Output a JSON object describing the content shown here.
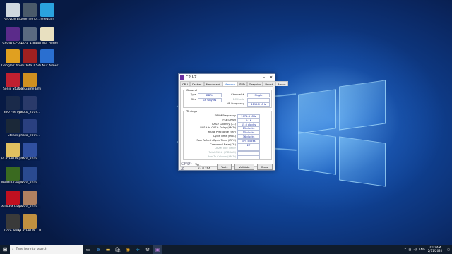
{
  "desktop_icons": [
    {
      "label": "Recycle Bin",
      "icon": "recycle-bin-icon",
      "color": "#cfd8e0"
    },
    {
      "label": "Core Temp...",
      "icon": "core-temp-shortcut-icon",
      "color": "#4a5a6a"
    },
    {
      "label": "Telegram",
      "icon": "telegram-icon",
      "color": "#2aa3de"
    },
    {
      "label": "CPUID CPU-Z",
      "icon": "cpu-z-icon",
      "color": "#5b2b8a"
    },
    {
      "label": "cpu-z_1.83...",
      "icon": "installer-icon",
      "color": "#5a6a80"
    },
    {
      "label": "Siti Nur Aimer Purwarni...",
      "icon": "document-icon",
      "color": "#e8e0c0"
    },
    {
      "label": "Google Chrome",
      "icon": "chrome-icon",
      "color": "#e0a020"
    },
    {
      "label": "Dota 2",
      "icon": "dota2-icon",
      "color": "#a02020"
    },
    {
      "label": "Siti Nur Aimer Purwarni...",
      "icon": "edge-document-icon",
      "color": "#2a6fd0"
    },
    {
      "label": "Sonic Studio",
      "icon": "sonic-studio-icon",
      "color": "#c02030"
    },
    {
      "label": "GeeGame Empire",
      "icon": "game-empire-icon",
      "color": "#d09020"
    },
    {
      "label": "SIIO File Pro",
      "icon": "file-pro-icon",
      "color": "#1a2a4a"
    },
    {
      "label": "photo_2019...",
      "icon": "photo-icon",
      "color": "#2a3a6a"
    },
    {
      "label": "Steam",
      "icon": "steam-icon",
      "color": "#1b2838"
    },
    {
      "label": "photo_2019...",
      "icon": "photo-icon",
      "color": "#2a4080"
    },
    {
      "label": "PLAYERUN... BATTLEGR...",
      "icon": "folder-icon",
      "color": "#e0c060"
    },
    {
      "label": "photo_2019...",
      "icon": "photo-icon",
      "color": "#3050a0"
    },
    {
      "label": "NVIDIA GeForce...",
      "icon": "nvidia-icon",
      "color": "#3a6a20"
    },
    {
      "label": "photo_2019...",
      "icon": "photo-icon",
      "color": "#2a4a90"
    },
    {
      "label": "AIDA64 Extreme",
      "icon": "aida64-icon",
      "color": "#c01020"
    },
    {
      "label": "photo_2019...",
      "icon": "photo-icon",
      "color": "#b08060"
    },
    {
      "label": "Core Temp",
      "icon": "core-temp-icon",
      "color": "#3a3a3a"
    },
    {
      "label": "PLAYERUN... BATTLEGR...",
      "icon": "pubg-icon",
      "color": "#c09040"
    }
  ],
  "cpuz": {
    "title": "CPU-Z",
    "tabs": [
      "CPU",
      "Caches",
      "Mainboard",
      "Memory",
      "SPD",
      "Graphics",
      "Bench",
      "About"
    ],
    "active_tab": "Memory",
    "general": {
      "title": "General",
      "type_label": "Type",
      "type_value": "DDR4",
      "size_label": "Size",
      "size_value": "16 GBytes",
      "channel_label": "Channel #",
      "channel_value": "Single",
      "dc_mode_label": "DC Mode",
      "nb_freq_label": "NB Frequency",
      "nb_freq_value": "4115.0 MHz"
    },
    "timings": {
      "title": "Timings",
      "rows": [
        {
          "label": "DRAM Frequency",
          "value": "1071.4 MHz",
          "dim": false
        },
        {
          "label": "FSB:DRAM",
          "value": "1:16",
          "dim": false
        },
        {
          "label": "CAS# Latency (CL)",
          "value": "15.0 clocks",
          "dim": false
        },
        {
          "label": "RAS# to CAS# Delay (tRCD)",
          "value": "15 clocks",
          "dim": false
        },
        {
          "label": "RAS# Precharge (tRP)",
          "value": "15 clocks",
          "dim": false
        },
        {
          "label": "Cycle Time (tRAS)",
          "value": "36 clocks",
          "dim": false
        },
        {
          "label": "Row Refresh Cycle Time (tRFC)",
          "value": "374 clocks",
          "dim": false
        },
        {
          "label": "Command Rate (CR)",
          "value": "2T",
          "dim": false
        },
        {
          "label": "DRAM Idle Timer",
          "value": "",
          "dim": true
        },
        {
          "label": "Total CAS# (tRDRAM)",
          "value": "",
          "dim": true
        },
        {
          "label": "Row To Column (tRCD)",
          "value": "",
          "dim": true
        }
      ]
    },
    "brand": "CPU-Z",
    "version": "Ver. 1.83.0.x64",
    "tools_label": "Tools",
    "validate_label": "Validate",
    "close_label": "Close"
  },
  "taskbar": {
    "search_placeholder": "Type here to search",
    "language": "ENG",
    "time": "2:10 AM",
    "date": "2/11/2020"
  }
}
